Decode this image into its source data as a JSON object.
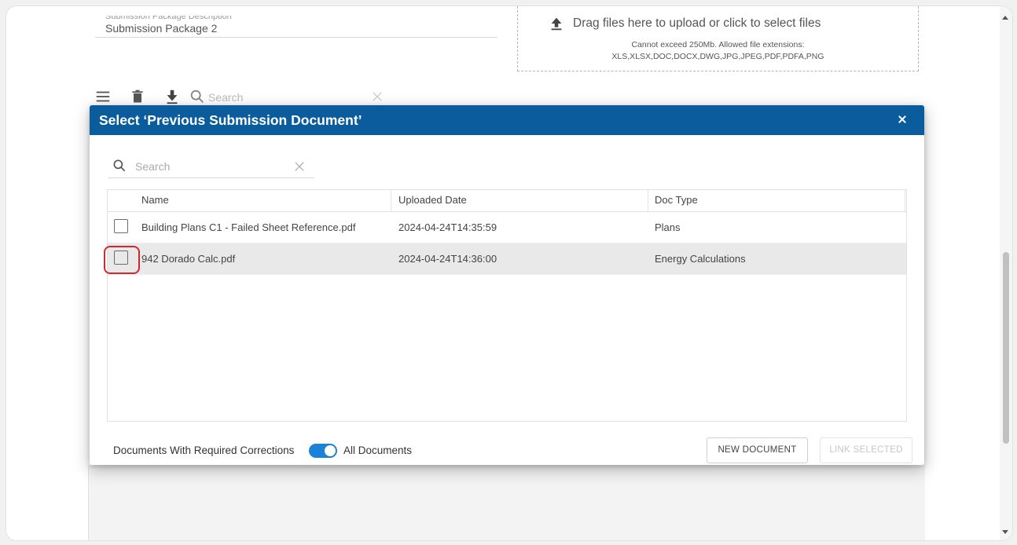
{
  "background": {
    "field_label": "Submission Package Description",
    "field_value": "Submission Package 2",
    "dropzone": {
      "title": "Drag files here to upload or click to select files",
      "limit_text": "Cannot exceed 250Mb. Allowed file extensions:",
      "extensions_text": "XLS,XLSX,DOC,DOCX,DWG,JPG,JPEG,PDF,PDFA,PNG"
    },
    "toolbar": {
      "search_placeholder": "Search"
    }
  },
  "modal": {
    "title": "Select ‘Previous Submission Document’",
    "search_placeholder": "Search",
    "columns": [
      "Name",
      "Uploaded Date",
      "Doc Type"
    ],
    "rows": [
      {
        "name": "Building Plans C1 - Failed Sheet Reference.pdf",
        "date": "2024-04-24T14:35:59",
        "doc_type": "Plans"
      },
      {
        "name": "942 Dorado Calc.pdf",
        "date": "2024-04-24T14:36:00",
        "doc_type": "Energy Calculations"
      }
    ],
    "filter": {
      "left_label": "Documents With Required Corrections",
      "right_label": "All Documents",
      "toggle_on": true
    },
    "buttons": {
      "new_document": "NEW DOCUMENT",
      "link_selected": "LINK SELECTED"
    }
  },
  "colors": {
    "header": "#0b5c9c",
    "toggle": "#1b82d8",
    "highlight": "#d3262d"
  }
}
